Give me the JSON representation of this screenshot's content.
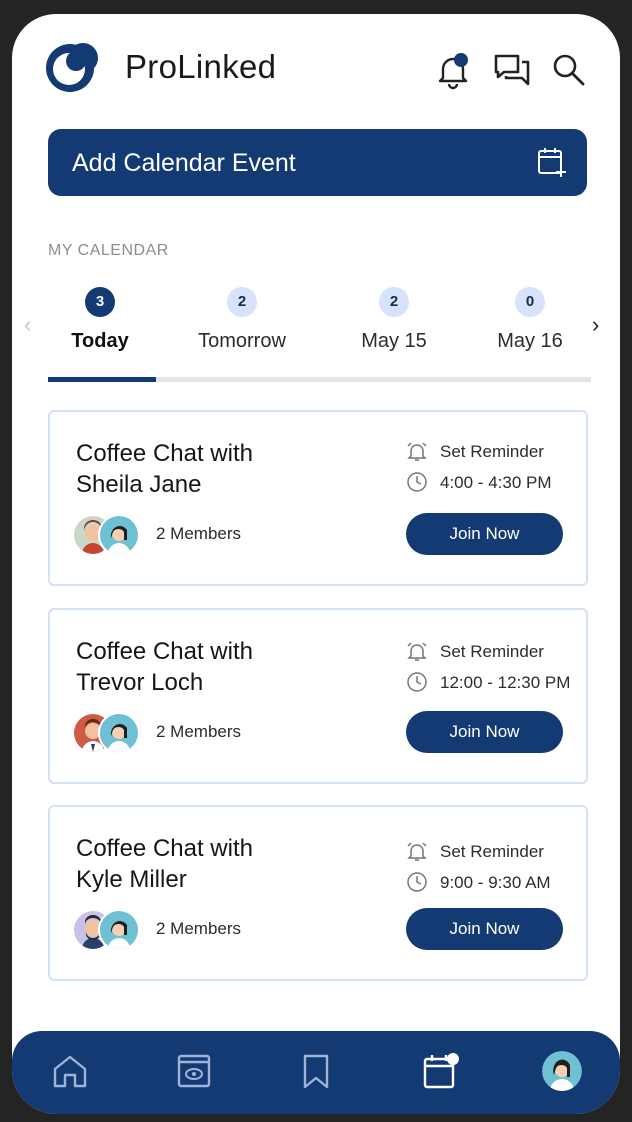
{
  "app": {
    "brand": "ProLinked",
    "accent": "#143a73",
    "light_accent": "#d6e3fb"
  },
  "header_icons": [
    "notification-bell-icon",
    "messages-icon",
    "search-icon"
  ],
  "add_event": {
    "label": "Add Calendar Event",
    "icon": "calendar-add-icon"
  },
  "calendar": {
    "section_label": "MY CALENDAR",
    "tabs": [
      {
        "count": "3",
        "label": "Today"
      },
      {
        "count": "2",
        "label": "Tomorrow"
      },
      {
        "count": "2",
        "label": "May 15"
      },
      {
        "count": "0",
        "label": "May 16"
      }
    ]
  },
  "events": [
    {
      "title_line1": "Coffee Chat with",
      "title_line2": "Sheila Jane",
      "members": "2 Members",
      "reminder": "Set Reminder",
      "time": "4:00 - 4:30 PM",
      "join": "Join Now"
    },
    {
      "title_line1": "Coffee Chat with",
      "title_line2": "Trevor Loch",
      "members": "2 Members",
      "reminder": "Set Reminder",
      "time": "12:00 - 12:30 PM",
      "join": "Join Now"
    },
    {
      "title_line1": "Coffee Chat with",
      "title_line2": "Kyle Miller",
      "members": "2 Members",
      "reminder": "Set Reminder",
      "time": "9:00 - 9:30 AM",
      "join": "Join Now"
    }
  ],
  "bottom_nav": [
    "home-icon",
    "watch-icon",
    "bookmark-icon",
    "calendar-icon",
    "profile-avatar"
  ]
}
